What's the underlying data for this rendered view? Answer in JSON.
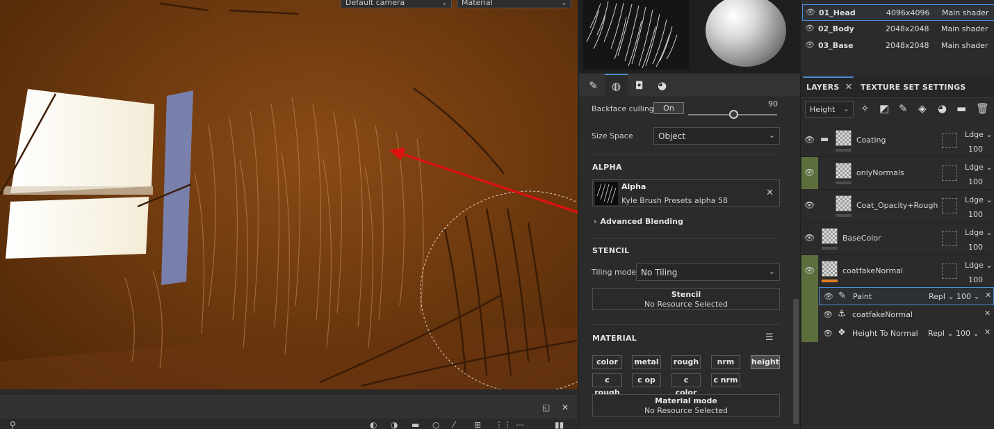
{
  "viewport": {
    "camera_dropdown": "Default camera",
    "channel_dropdown": "Material"
  },
  "preview": {},
  "mid_tabs": [
    "brush-icon",
    "alpha-icon",
    "stencil-icon",
    "material-icon"
  ],
  "properties": {
    "backface_culling_label": "Backface culling",
    "backface_culling_value": "On",
    "slider_value": "90",
    "size_space_label": "Size Space",
    "size_space_value": "Object"
  },
  "alpha": {
    "section_title": "ALPHA",
    "name": "Alpha",
    "resource": "Kyle Brush Presets alpha 58",
    "advanced_blending": "Advanced Blending"
  },
  "stencil": {
    "section_title": "STENCIL",
    "tiling_label": "Tiling mode",
    "tiling_value": "No Tiling",
    "box_title": "Stencil",
    "box_subtitle": "No Resource Selected"
  },
  "material": {
    "section_title": "MATERIAL",
    "chips": [
      {
        "label": "color"
      },
      {
        "label": "metal"
      },
      {
        "label": "rough"
      },
      {
        "label": "nrm"
      },
      {
        "label": "height"
      },
      {
        "label": "c rough"
      },
      {
        "label": "c op"
      },
      {
        "label": "c color"
      },
      {
        "label": "c nrm"
      }
    ],
    "active_chip": "height",
    "mode_title": "Material mode",
    "mode_subtitle": "No Resource Selected"
  },
  "texture_sets": [
    {
      "name": "01_Head",
      "resolution": "4096x4096",
      "shader": "Main shader",
      "selected": true
    },
    {
      "name": "02_Body",
      "resolution": "2048x2048",
      "shader": "Main shader",
      "selected": false
    },
    {
      "name": "03_Base",
      "resolution": "2048x2048",
      "shader": "Main shader",
      "selected": false
    }
  ],
  "right_tabs": {
    "layers": "LAYERS",
    "texture_set_settings": "TEXTURE SET SETTINGS"
  },
  "layer_toolbar": {
    "channel_select": "Height"
  },
  "layers": [
    {
      "name": "Coating",
      "blend": "Ldge",
      "opacity": "100"
    },
    {
      "name": "onlyNormals",
      "blend": "Ldge",
      "opacity": "100"
    },
    {
      "name": "Coat_Opacity+Rough",
      "blend": "Ldge",
      "opacity": "100"
    },
    {
      "name": "BaseColor",
      "blend": "Ldge",
      "opacity": "100"
    },
    {
      "name": "coatfakeNormal",
      "blend": "Ldge",
      "opacity": "100"
    }
  ],
  "effects": [
    {
      "name": "Paint",
      "blend": "Repl",
      "opacity": "100"
    },
    {
      "name": "coatfakeNormal",
      "blend": "",
      "opacity": ""
    },
    {
      "name": "Height To Normal",
      "blend": "Repl",
      "opacity": "100"
    }
  ],
  "colors": {
    "accent": "#4a8fd6",
    "annotation_arrow": "#e01010",
    "green_group": "#5b6e3c",
    "orange_bar": "#e07c23"
  }
}
